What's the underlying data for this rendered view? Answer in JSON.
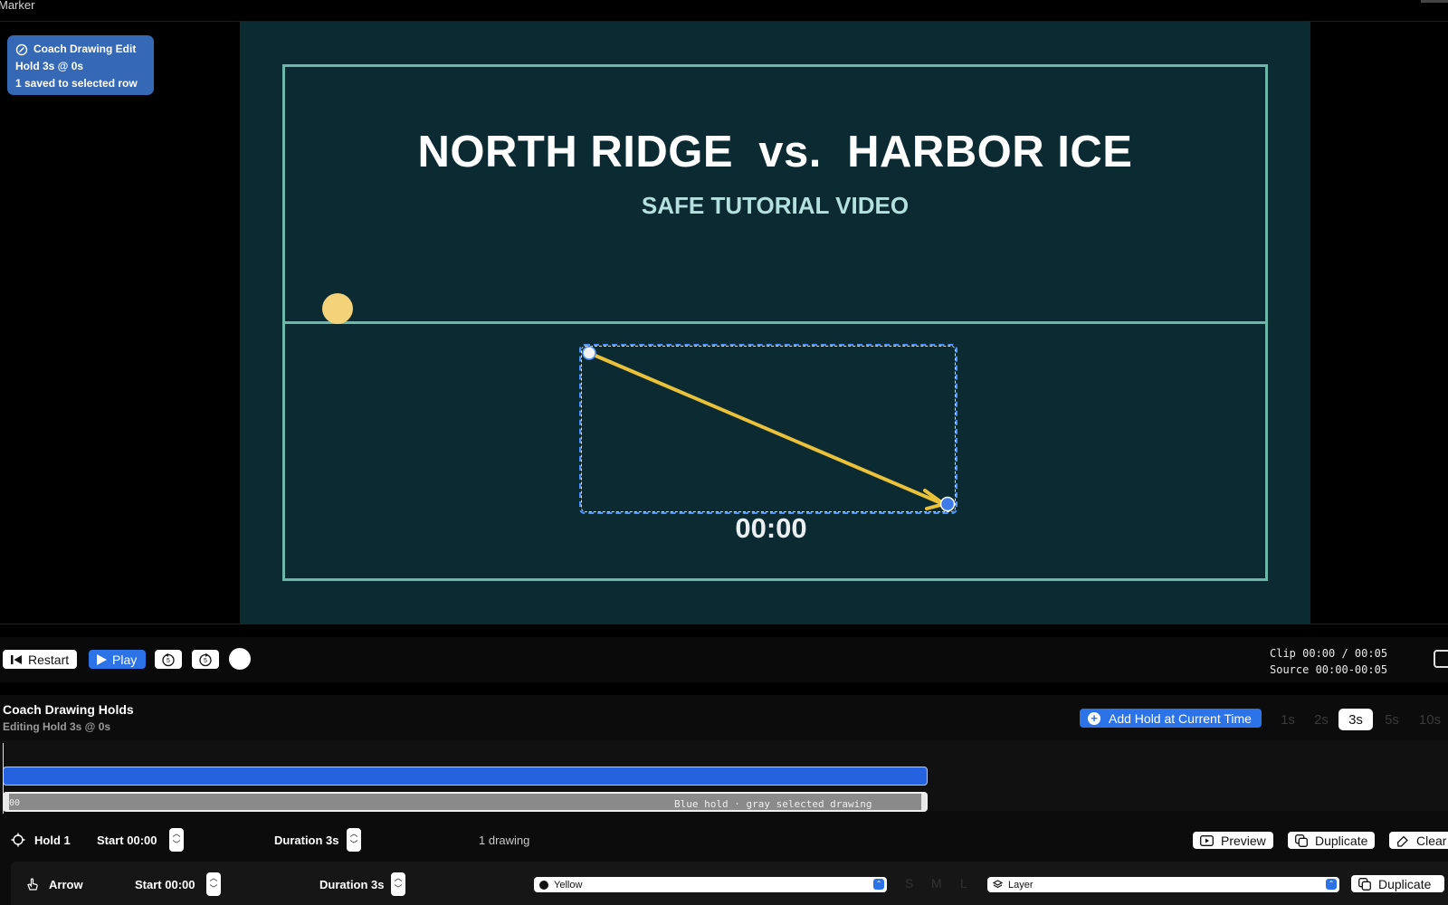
{
  "window": {
    "title": "Marker"
  },
  "edit_badge": {
    "title": "Coach Drawing Edit",
    "line2": "Hold 3s @ 0s",
    "line3": "1 saved to selected row"
  },
  "video": {
    "match_title": "NORTH RIDGE  vs.  HARBOR ICE",
    "subtitle": "SAFE TUTORIAL VIDEO",
    "timestamp": "00:00",
    "colors": {
      "court_line": "#6bb8ab",
      "ball": "#f4d27a",
      "arrow": "#e9c23a",
      "selection": "#4d93ff"
    }
  },
  "transport": {
    "restart_label": "Restart",
    "play_label": "Play",
    "icons": [
      "skip-back-5-icon",
      "skip-forward-5-icon",
      "record-dot-icon"
    ],
    "clip": "Clip 00:00 / 00:05",
    "source": "Source 00:00-00:05"
  },
  "holds_panel": {
    "title": "Coach Drawing Holds",
    "subtitle": "Editing Hold 3s @ 0s",
    "add_hold_label": "Add Hold at Current Time",
    "durations": [
      "1s",
      "2s",
      "3s",
      "5s",
      "10s"
    ],
    "selected_duration": "3s",
    "timeline": {
      "start_label": "00",
      "note": "Blue hold · gray selected drawing"
    }
  },
  "hold_row": {
    "name": "Hold 1",
    "start": "Start 00:00",
    "duration": "Duration 3s",
    "drawing_count": "1 drawing",
    "preview_label": "Preview",
    "duplicate_label": "Duplicate",
    "clear_label": "Clear"
  },
  "drawing_row": {
    "tool": "Arrow",
    "start": "Start 00:00",
    "duration": "Duration 3s",
    "color": "Yellow",
    "sizes": [
      "S",
      "M",
      "L"
    ],
    "layer": "Layer",
    "duplicate_label": "Duplicate"
  }
}
